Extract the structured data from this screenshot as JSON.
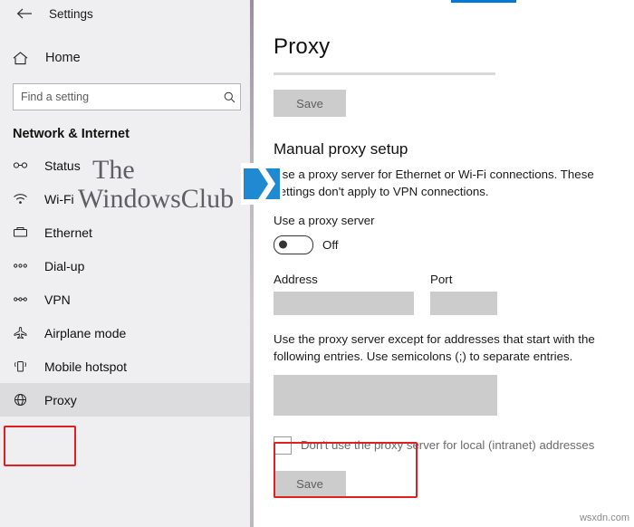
{
  "sidebar": {
    "back_icon": "back-arrow-icon",
    "title": "Settings",
    "home": {
      "icon": "home-icon",
      "label": "Home"
    },
    "search": {
      "placeholder": "Find a setting",
      "value": "",
      "icon": "search-icon"
    },
    "section_header": "Network & Internet",
    "items": [
      {
        "label": "Status",
        "icon": "status-icon"
      },
      {
        "label": "Wi-Fi",
        "icon": "wifi-icon"
      },
      {
        "label": "Ethernet",
        "icon": "ethernet-icon"
      },
      {
        "label": "Dial-up",
        "icon": "dialup-icon"
      },
      {
        "label": "VPN",
        "icon": "vpn-icon"
      },
      {
        "label": "Airplane mode",
        "icon": "airplane-icon"
      },
      {
        "label": "Mobile hotspot",
        "icon": "hotspot-icon"
      },
      {
        "label": "Proxy",
        "icon": "globe-icon"
      }
    ]
  },
  "main": {
    "title": "Proxy",
    "save_top_label": "Save",
    "manual_heading": "Manual proxy setup",
    "manual_description": "Use a proxy server for Ethernet or Wi-Fi connections. These settings don't apply to VPN connections.",
    "use_proxy_label": "Use a proxy server",
    "use_proxy_state": "Off",
    "address_label": "Address",
    "address_value": "",
    "port_label": "Port",
    "port_value": "",
    "exceptions_description": "Use the proxy server except for addresses that start with the following entries. Use semicolons (;) to separate entries.",
    "exceptions_value": "",
    "local_checkbox_label": "Don't use the proxy server for local (intranet) addresses",
    "save_bottom_label": "Save"
  },
  "watermark": {
    "line1": "The",
    "line2": "WindowsClub",
    "logo_icon": "windows-club-logo-icon",
    "corner": "wsxdn.com"
  },
  "colors": {
    "accent": "#0078d7",
    "highlight_box": "#e02020",
    "sidebar_bg": "#efeff1",
    "field_bg": "#cccccc"
  }
}
